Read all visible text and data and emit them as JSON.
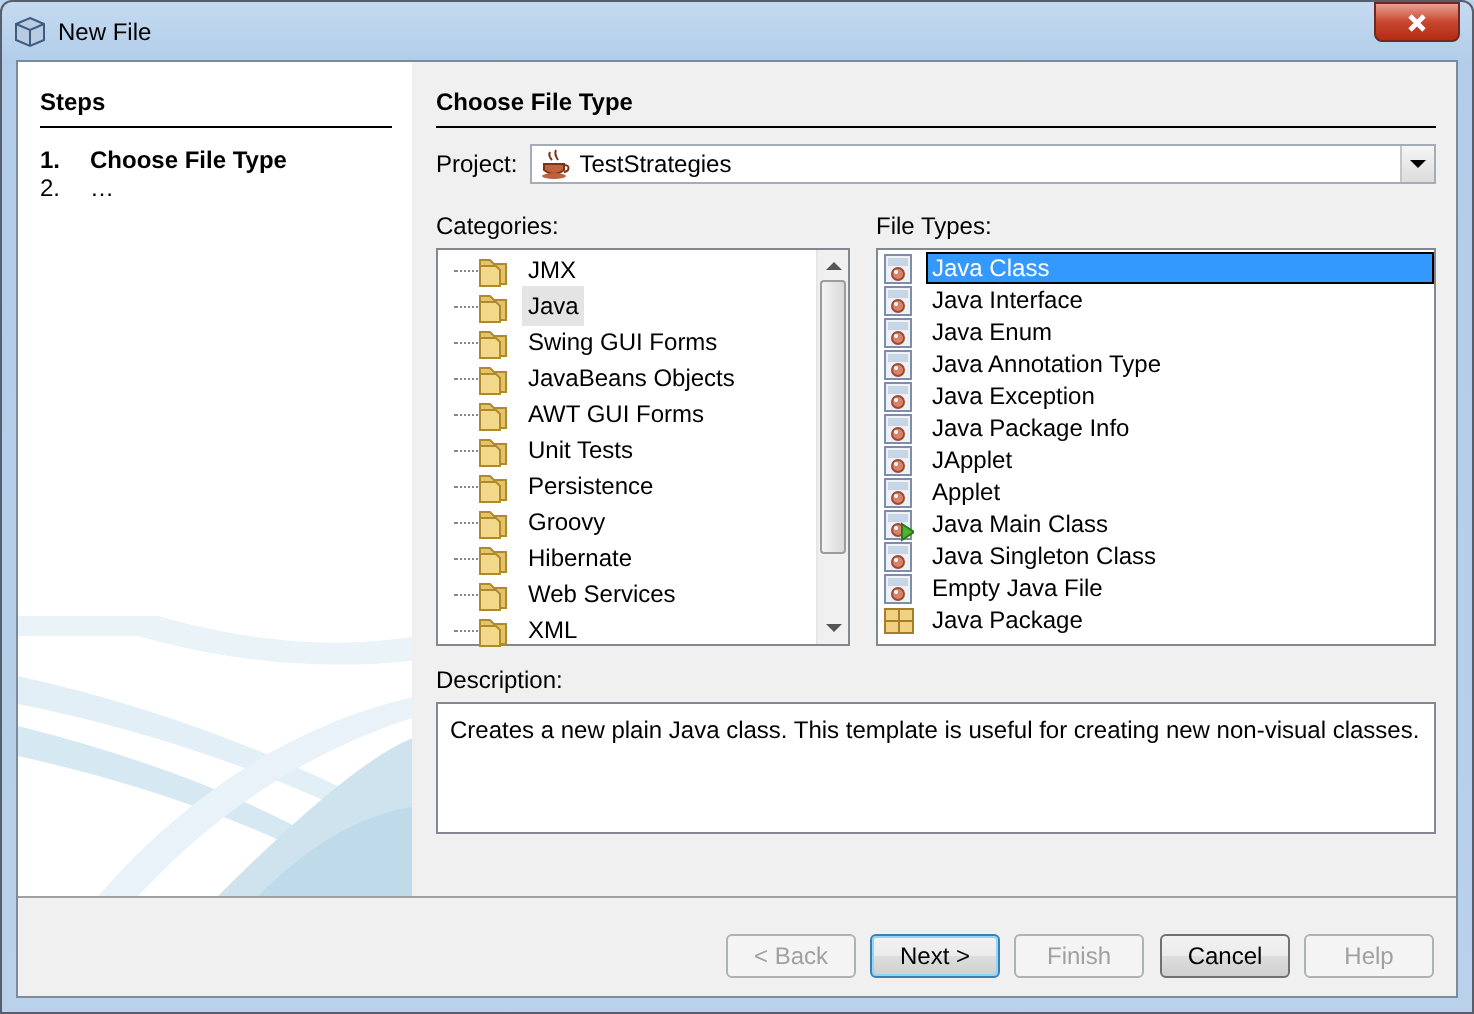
{
  "window": {
    "title": "New File"
  },
  "steps": {
    "title": "Steps",
    "items": [
      {
        "number": "1.",
        "label": "Choose File Type",
        "selected": true
      },
      {
        "number": "2.",
        "label": "…",
        "selected": false
      }
    ]
  },
  "panel_title": "Choose File Type",
  "project": {
    "label": "Project:",
    "value": "TestStrategies"
  },
  "categories": {
    "label": "Categories:",
    "items": [
      {
        "label": "JMX",
        "selected": false
      },
      {
        "label": "Java",
        "selected": true
      },
      {
        "label": "Swing GUI Forms",
        "selected": false
      },
      {
        "label": "JavaBeans Objects",
        "selected": false
      },
      {
        "label": "AWT GUI Forms",
        "selected": false
      },
      {
        "label": "Unit Tests",
        "selected": false
      },
      {
        "label": "Persistence",
        "selected": false
      },
      {
        "label": "Groovy",
        "selected": false
      },
      {
        "label": "Hibernate",
        "selected": false
      },
      {
        "label": "Web Services",
        "selected": false
      },
      {
        "label": "XML",
        "selected": false
      }
    ]
  },
  "file_types": {
    "label": "File Types:",
    "items": [
      {
        "label": "Java Class",
        "selected": true,
        "kind": "class"
      },
      {
        "label": "Java Interface",
        "selected": false,
        "kind": "class"
      },
      {
        "label": "Java Enum",
        "selected": false,
        "kind": "class"
      },
      {
        "label": "Java Annotation Type",
        "selected": false,
        "kind": "class"
      },
      {
        "label": "Java Exception",
        "selected": false,
        "kind": "class"
      },
      {
        "label": "Java Package Info",
        "selected": false,
        "kind": "class"
      },
      {
        "label": "JApplet",
        "selected": false,
        "kind": "class"
      },
      {
        "label": "Applet",
        "selected": false,
        "kind": "class"
      },
      {
        "label": "Java Main Class",
        "selected": false,
        "kind": "main"
      },
      {
        "label": "Java Singleton Class",
        "selected": false,
        "kind": "class"
      },
      {
        "label": "Empty Java File",
        "selected": false,
        "kind": "class"
      },
      {
        "label": "Java Package",
        "selected": false,
        "kind": "package"
      }
    ]
  },
  "description": {
    "label": "Description:",
    "text": "Creates a new plain Java class. This template is useful for creating new non-visual classes."
  },
  "buttons": [
    {
      "label": "< Back",
      "disabled": true,
      "default": false
    },
    {
      "label": "Next >",
      "disabled": false,
      "default": true
    },
    {
      "label": "Finish",
      "disabled": true,
      "default": false
    },
    {
      "label": "Cancel",
      "disabled": false,
      "default": false
    },
    {
      "label": "Help",
      "disabled": true,
      "default": false
    }
  ]
}
